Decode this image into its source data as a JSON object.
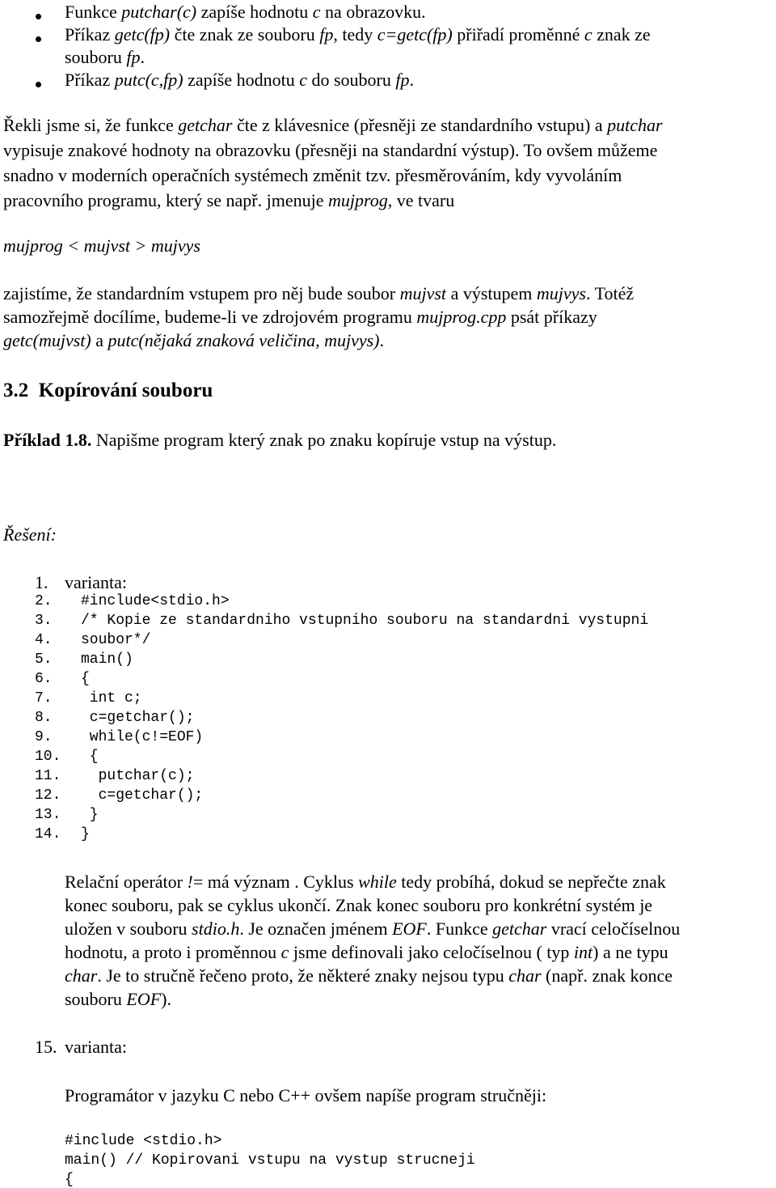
{
  "bullets": [
    {
      "lines": [
        [
          {
            "t": "Funkce ",
            "i": false
          },
          {
            "t": "putchar(c)",
            "i": true
          },
          {
            "t": " zapíše hodnotu ",
            "i": false
          },
          {
            "t": "c",
            "i": true
          },
          {
            "t": " na obrazovku.",
            "i": false
          }
        ]
      ]
    },
    {
      "lines": [
        [
          {
            "t": "Příkaz ",
            "i": false
          },
          {
            "t": "getc(fp)",
            "i": true
          },
          {
            "t": " čte znak ze souboru ",
            "i": false
          },
          {
            "t": "fp",
            "i": true
          },
          {
            "t": ", tedy ",
            "i": false
          },
          {
            "t": "c=getc(fp)",
            "i": true
          },
          {
            "t": " přiřadí proměnné ",
            "i": false
          },
          {
            "t": "c",
            "i": true
          },
          {
            "t": " znak ze",
            "i": false
          }
        ],
        [
          {
            "t": "souboru ",
            "i": false
          },
          {
            "t": "fp",
            "i": true
          },
          {
            "t": ".",
            "i": false
          }
        ]
      ]
    },
    {
      "lines": [
        [
          {
            "t": "Příkaz ",
            "i": false
          },
          {
            "t": "putc(c,fp)",
            "i": true
          },
          {
            "t": " zapíše hodnotu ",
            "i": false
          },
          {
            "t": "c",
            "i": true
          },
          {
            "t": " do souboru ",
            "i": false
          },
          {
            "t": "fp",
            "i": true
          },
          {
            "t": ".",
            "i": false
          }
        ]
      ]
    }
  ],
  "intro_paragraph": [
    [
      {
        "t": "Řekli jsme si, že funkce ",
        "i": false
      },
      {
        "t": "getchar",
        "i": true
      },
      {
        "t": " čte z klávesnice (přesněji ze standardního vstupu) a ",
        "i": false
      },
      {
        "t": "putchar",
        "i": true
      }
    ],
    [
      {
        "t": "vypisuje znakové hodnoty na obrazovku (přesněji na standardní výstup). To ovšem můžeme",
        "i": false
      }
    ],
    [
      {
        "t": "snadno v moderních operačních systémech změnit tzv. přesměrováním, kdy vyvoláním",
        "i": false
      }
    ],
    [
      {
        "t": "pracovního programu, který se např. jmenuje ",
        "i": false
      },
      {
        "t": "mujprog",
        "i": true
      },
      {
        "t": ", ve tvaru",
        "i": false
      }
    ]
  ],
  "redirect_example": "mujprog < mujvst > mujvys",
  "redirect_paragraph": [
    [
      {
        "t": "zajistíme, že standardním vstupem pro něj bude soubor ",
        "i": false
      },
      {
        "t": "mujvst",
        "i": true
      },
      {
        "t": " a výstupem ",
        "i": false
      },
      {
        "t": "mujvys",
        "i": true
      },
      {
        "t": ". Totéž",
        "i": false
      }
    ],
    [
      {
        "t": "samozřejmě docílíme, budeme-li ve zdrojovém programu ",
        "i": false
      },
      {
        "t": "mujprog.cpp",
        "i": true
      },
      {
        "t": " psát příkazy",
        "i": false
      }
    ],
    [
      {
        "t": "getc(mujvst)",
        "i": true
      },
      {
        "t": " a ",
        "i": false
      },
      {
        "t": "putc(nějaká znaková veličina, mujvys)",
        "i": true
      },
      {
        "t": ".",
        "i": false
      }
    ]
  ],
  "section_heading": "3.2  Kopírování souboru",
  "example": {
    "label": "Příklad 1.8.",
    "text": " Napišme program který znak po znaku kopíruje vstup na výstup."
  },
  "solution_label": "Řešení:",
  "variant1": {
    "number": "1.",
    "label": "varianta:"
  },
  "code_lines": [
    {
      "n": "2.",
      "code": "#include<stdio.h>"
    },
    {
      "n": "3.",
      "code": "/* Kopie ze standardniho vstupniho souboru na standardni vystupni"
    },
    {
      "n": "4.",
      "code": "soubor*/"
    },
    {
      "n": "5.",
      "code": "main()"
    },
    {
      "n": "6.",
      "code": "{"
    },
    {
      "n": "7.",
      "code": " int c;"
    },
    {
      "n": "8.",
      "code": " c=getchar();"
    },
    {
      "n": "9.",
      "code": " while(c!=EOF)"
    },
    {
      "n": "10.",
      "code": " {"
    },
    {
      "n": "11.",
      "code": "  putchar(c);"
    },
    {
      "n": "12.",
      "code": "  c=getchar();"
    },
    {
      "n": "13.",
      "code": " }"
    },
    {
      "n": "14.",
      "code": "}"
    }
  ],
  "explanation_paragraph": [
    [
      {
        "t": "Relační operátor ",
        "i": false
      },
      {
        "t": "!",
        "i": true
      },
      {
        "t": "= má význam . Cyklus ",
        "i": false
      },
      {
        "t": "while",
        "i": true
      },
      {
        "t": " tedy probíhá, dokud se nepřečte znak",
        "i": false
      }
    ],
    [
      {
        "t": "konec souboru, pak se cyklus ukončí. Znak konec souboru pro konkrétní systém je",
        "i": false
      }
    ],
    [
      {
        "t": "uložen v souboru ",
        "i": false
      },
      {
        "t": "stdio.h",
        "i": true
      },
      {
        "t": ". Je označen jménem ",
        "i": false
      },
      {
        "t": "EOF",
        "i": true
      },
      {
        "t": ". Funkce ",
        "i": false
      },
      {
        "t": "getchar",
        "i": true
      },
      {
        "t": " vrací celočíselnou",
        "i": false
      }
    ],
    [
      {
        "t": "hodnotu, a proto i proměnnou ",
        "i": false
      },
      {
        "t": "c",
        "i": true
      },
      {
        "t": " jsme definovali jako celočíselnou ( typ ",
        "i": false
      },
      {
        "t": "int",
        "i": true
      },
      {
        "t": ") a ne typu",
        "i": false
      }
    ],
    [
      {
        "t": "char",
        "i": true
      },
      {
        "t": ". Je to stručně řečeno proto, že některé znaky nejsou typu ",
        "i": false
      },
      {
        "t": "char",
        "i": true
      },
      {
        "t": " (např. znak konce",
        "i": false
      }
    ],
    [
      {
        "t": "souboru ",
        "i": false
      },
      {
        "t": "EOF",
        "i": true
      },
      {
        "t": ").",
        "i": false
      }
    ]
  ],
  "variant2": {
    "number": "15.",
    "label": "varianta:"
  },
  "variant2_intro": "Programátor v jazyku C nebo C++ ovšem napíše program stručněji:",
  "short_code_lines": [
    "#include <stdio.h>",
    "main() // Kopirovani vstupu na vystup strucneji",
    "{"
  ]
}
